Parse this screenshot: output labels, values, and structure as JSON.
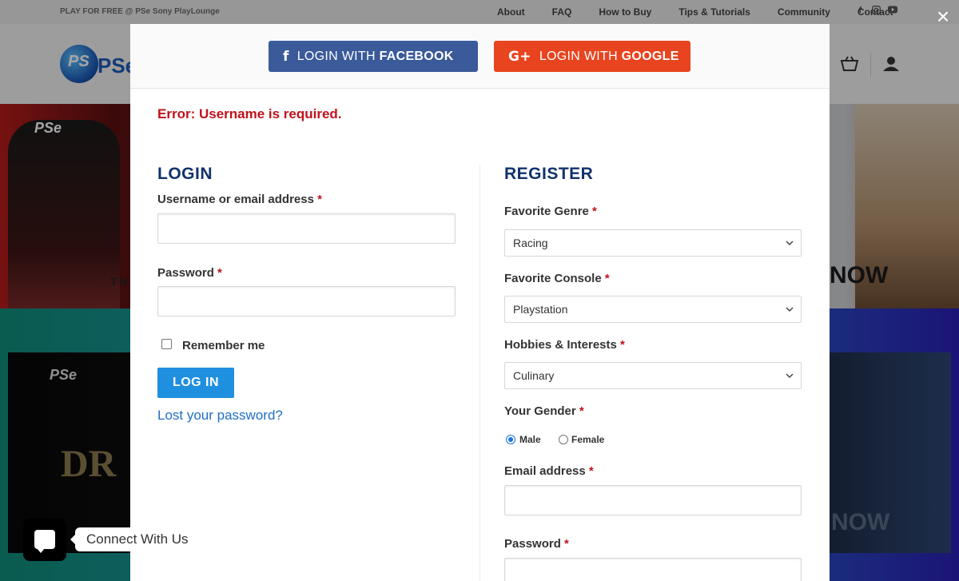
{
  "topbar": {
    "promo": "PLAY FOR FREE @ PSe Sony PlayLounge",
    "nav": [
      "About",
      "FAQ",
      "How to Buy",
      "Tips & Tutorials",
      "Community",
      "Contact"
    ],
    "social_icons": [
      "facebook-icon",
      "instagram-icon",
      "youtube-icon"
    ]
  },
  "header": {
    "logo_mark": "PS",
    "logo_text": "PSegam",
    "icons": [
      "cart-icon",
      "user-icon"
    ]
  },
  "hero": {
    "brand": "PSe",
    "title_fragment": "THI",
    "cta": "NOW"
  },
  "banner2": {
    "brand": "PSe",
    "title_fragment": "DR",
    "cta": "NOW"
  },
  "modal": {
    "close_glyph": "×",
    "facebook": {
      "prefix": "LOGIN WITH",
      "brand": "FACEBOOK",
      "icon": "f"
    },
    "google": {
      "prefix": "LOGIN WITH",
      "brand": "GOOGLE",
      "icon": "G+"
    },
    "error": {
      "label": "Error:",
      "message": "Username is required."
    },
    "login": {
      "heading": "LOGIN",
      "username_label": "Username or email address",
      "username_value": "",
      "password_label": "Password",
      "password_value": "",
      "remember_label": "Remember me",
      "remember_checked": false,
      "submit_label": "LOG IN",
      "lost_password": "Lost your password?"
    },
    "register": {
      "heading": "REGISTER",
      "genre_label": "Favorite Genre",
      "genre_value": "Racing",
      "console_label": "Favorite Console",
      "console_value": "Playstation",
      "hobbies_label": "Hobbies & Interests",
      "hobbies_value": "Culinary",
      "gender_label": "Your Gender",
      "gender_options": [
        "Male",
        "Female"
      ],
      "gender_selected": "Male",
      "email_label": "Email address",
      "email_value": "",
      "password_label": "Password",
      "password_value": ""
    },
    "required_mark": "*"
  },
  "connect_widget": {
    "label": "Connect With Us"
  },
  "colors": {
    "facebook": "#3b5a9a",
    "google": "#e8441f",
    "primary_button": "#1f8fe0",
    "heading": "#12326b",
    "error": "#c0121b"
  }
}
